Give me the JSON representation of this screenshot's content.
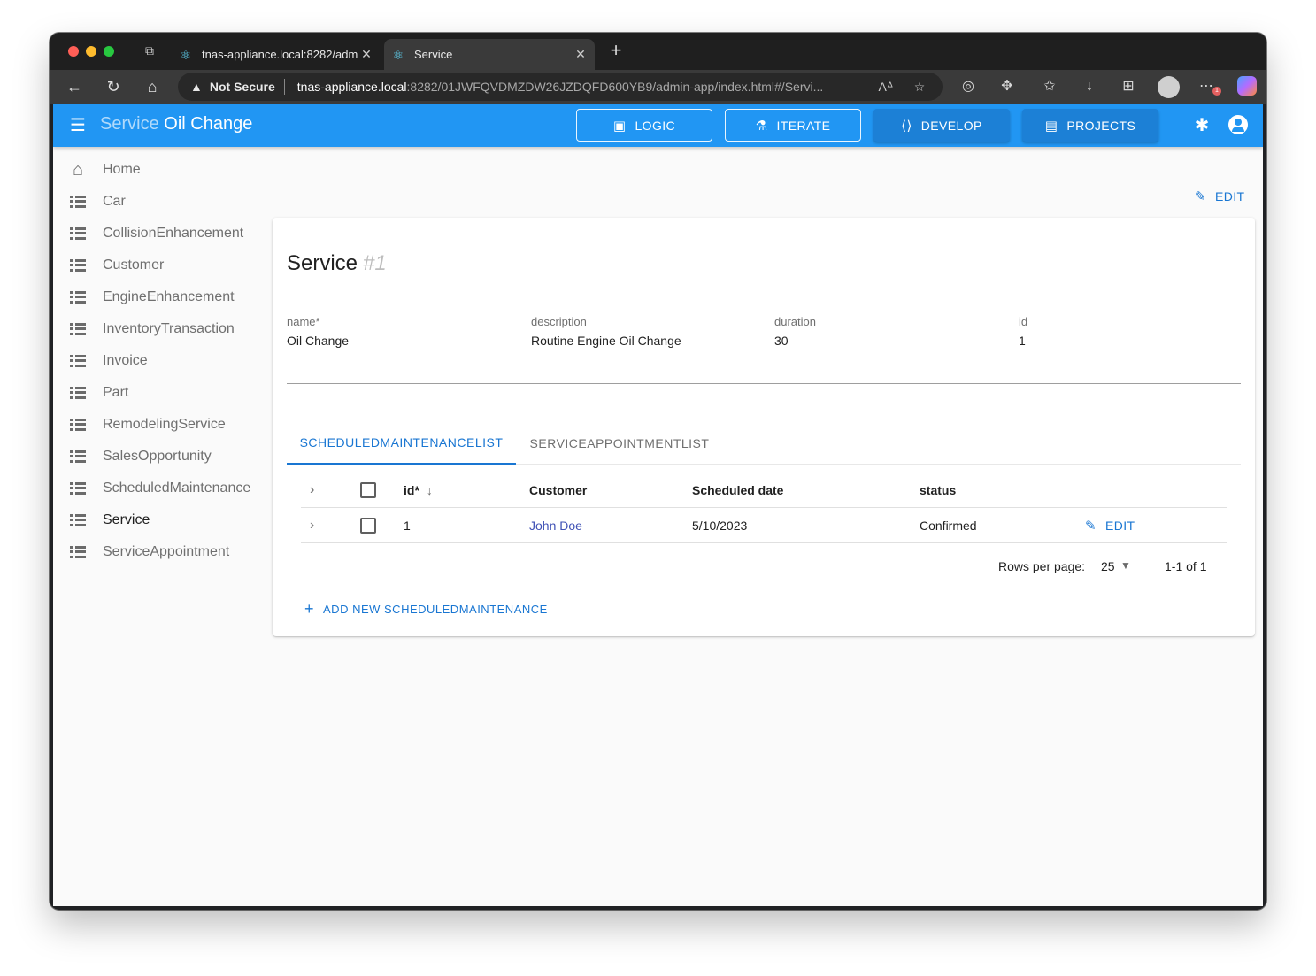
{
  "browser": {
    "tabs": [
      {
        "title": "tnas-appliance.local:8282/adm",
        "active": false
      },
      {
        "title": "Service",
        "active": true
      }
    ],
    "security_label": "Not Secure",
    "url_host": "tnas-appliance.local",
    "url_path": ":8282/01JWFQVDMZDW26JZDQFD600YB9/admin-app/index.html#/Servi...",
    "extension_badge": "1"
  },
  "appbar": {
    "title_prefix": "Service",
    "title_main": "Oil Change",
    "buttons": [
      {
        "label": "LOGIC",
        "icon": "chip-icon",
        "style": "outline"
      },
      {
        "label": "ITERATE",
        "icon": "flask-icon",
        "style": "outline"
      },
      {
        "label": "DEVELOP",
        "icon": "code-icon",
        "style": "filled"
      },
      {
        "label": "PROJECTS",
        "icon": "list-box-icon",
        "style": "filled"
      }
    ]
  },
  "sidebar": {
    "items": [
      {
        "label": "Home",
        "icon": "home-icon"
      },
      {
        "label": "Car",
        "icon": "list-icon"
      },
      {
        "label": "CollisionEnhancement",
        "icon": "list-icon"
      },
      {
        "label": "Customer",
        "icon": "list-icon"
      },
      {
        "label": "EngineEnhancement",
        "icon": "list-icon"
      },
      {
        "label": "InventoryTransaction",
        "icon": "list-icon"
      },
      {
        "label": "Invoice",
        "icon": "list-icon"
      },
      {
        "label": "Part",
        "icon": "list-icon"
      },
      {
        "label": "RemodelingService",
        "icon": "list-icon"
      },
      {
        "label": "SalesOpportunity",
        "icon": "list-icon"
      },
      {
        "label": "ScheduledMaintenance",
        "icon": "list-icon"
      },
      {
        "label": "Service",
        "icon": "list-icon",
        "active": true
      },
      {
        "label": "ServiceAppointment",
        "icon": "list-icon"
      }
    ]
  },
  "page": {
    "edit_label": "EDIT",
    "record_type": "Service",
    "record_id": "#1",
    "fields": [
      {
        "label": "name*",
        "value": "Oil Change"
      },
      {
        "label": "description",
        "value": "Routine Engine Oil Change"
      },
      {
        "label": "duration",
        "value": "30"
      },
      {
        "label": "id",
        "value": "1"
      }
    ],
    "tabs": [
      {
        "label": "SCHEDULEDMAINTENANCELIST",
        "active": true
      },
      {
        "label": "SERVICEAPPOINTMENTLIST",
        "active": false
      }
    ],
    "table": {
      "columns": [
        "id*",
        "Customer",
        "Scheduled date",
        "status"
      ],
      "rows": [
        {
          "id": "1",
          "customer": "John Doe",
          "scheduled_date": "5/10/2023",
          "status": "Confirmed",
          "edit": "EDIT"
        }
      ]
    },
    "pagination": {
      "rows_per_page_label": "Rows per page:",
      "rows_per_page": "25",
      "range": "1-1 of 1"
    },
    "add_new_label": "ADD NEW SCHEDULEDMAINTENANCE"
  },
  "colors": {
    "appbar": "#2196f3",
    "accent": "#1976d2",
    "link": "#3f51b5"
  }
}
